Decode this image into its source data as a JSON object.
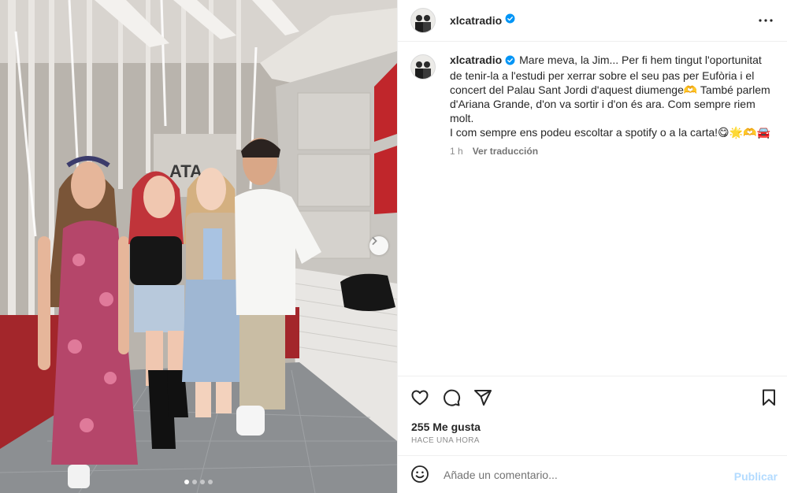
{
  "post": {
    "username": "xlcatradio",
    "verified": true,
    "caption": "Mare meva, la Jim... Per fi hem tingut l'oportunitat de tenir-la a l'estudi per xerrar sobre el seu pas per Eufòria i el concert del Palau Sant Jordi d'aquest diumenge🫶 També parlem d'Ariana Grande, d'on va sortir i d'on és ara. Com sempre riem molt.\nI com sempre ens podeu escoltar a spotify o a la carta!😋🌟🫶🚘",
    "time_ago": "1 h",
    "translate_label": "Ver traducción",
    "likes": "255 Me gusta",
    "timestamp": "HACE UNA HORA",
    "comment_placeholder": "Añade un comentario...",
    "publish_label": "Publicar",
    "carousel": {
      "count": 4,
      "active": 0
    }
  },
  "colors": {
    "verified": "#0095f6",
    "publish_disabled": "#b3dbff",
    "muted_text": "#8e8e8e"
  },
  "icons": {
    "more": "more-options-icon",
    "like": "heart-icon",
    "comment": "comment-icon",
    "share": "paper-plane-icon",
    "save": "bookmark-icon",
    "emoji": "smiley-icon",
    "next": "chevron-right-icon"
  }
}
